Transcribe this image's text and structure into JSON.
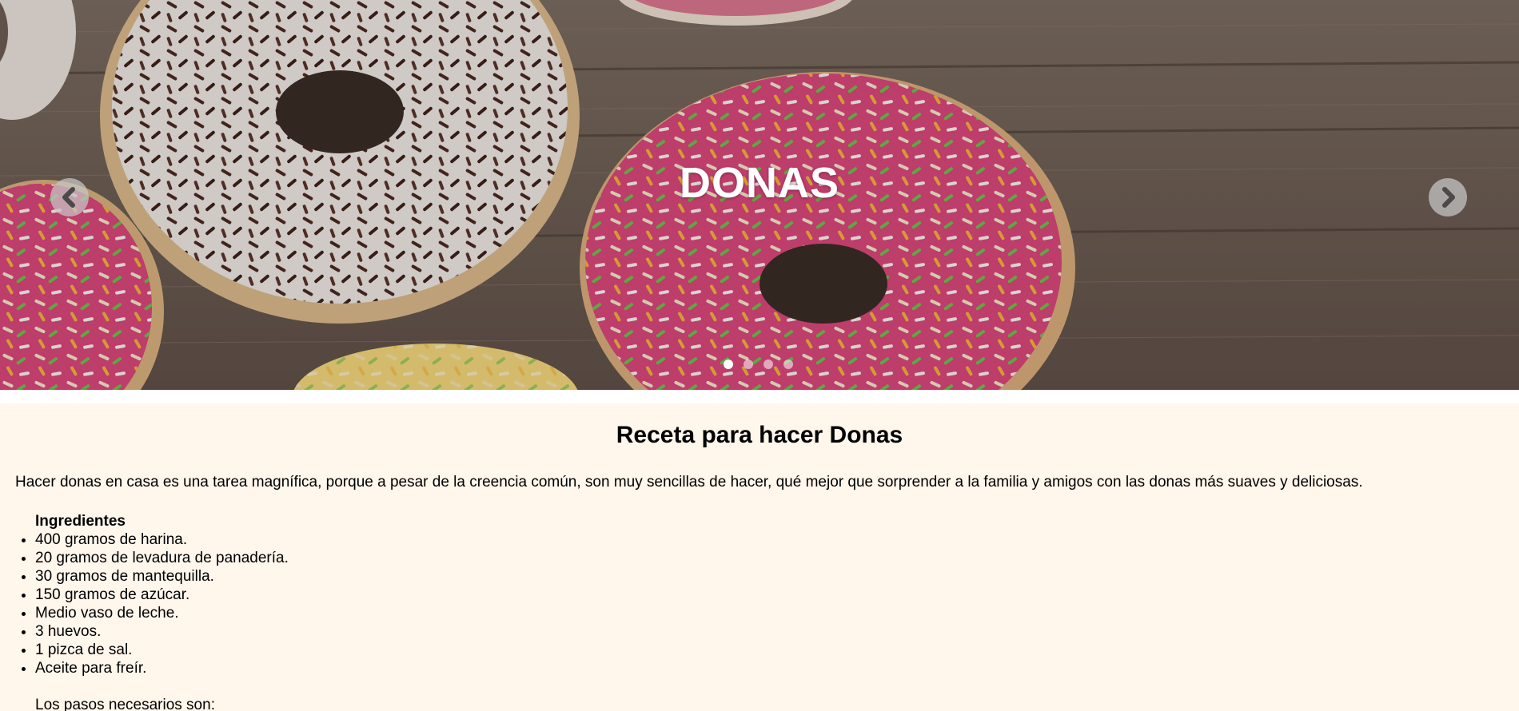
{
  "carousel": {
    "caption": "DONAS",
    "prev_icon": "chevron-left-icon",
    "next_icon": "chevron-right-icon",
    "slide_count": 4,
    "active_slide": 1
  },
  "recipe": {
    "title": "Receta para hacer Donas",
    "intro": "Hacer donas en casa es una tarea magnífica, porque a pesar de la creencia común, son muy sencillas de hacer, qué mejor que sorprender a la familia y amigos con las donas más suaves y deliciosas.",
    "ingredients_title": "Ingredientes",
    "ingredients": [
      "400 gramos de harina.",
      "20 gramos de levadura de panadería.",
      "30 gramos de mantequilla.",
      "150 gramos de azúcar.",
      "Medio vaso de leche.",
      "3 huevos.",
      "1 pizca de sal.",
      "Aceite para freír."
    ],
    "steps_intro": "Los pasos necesarios son:"
  },
  "colors": {
    "page_background": "#fff6ec",
    "pink_glaze": "#d8467a",
    "white_glaze": "#efe9e6",
    "wood": "#6d5d51"
  }
}
